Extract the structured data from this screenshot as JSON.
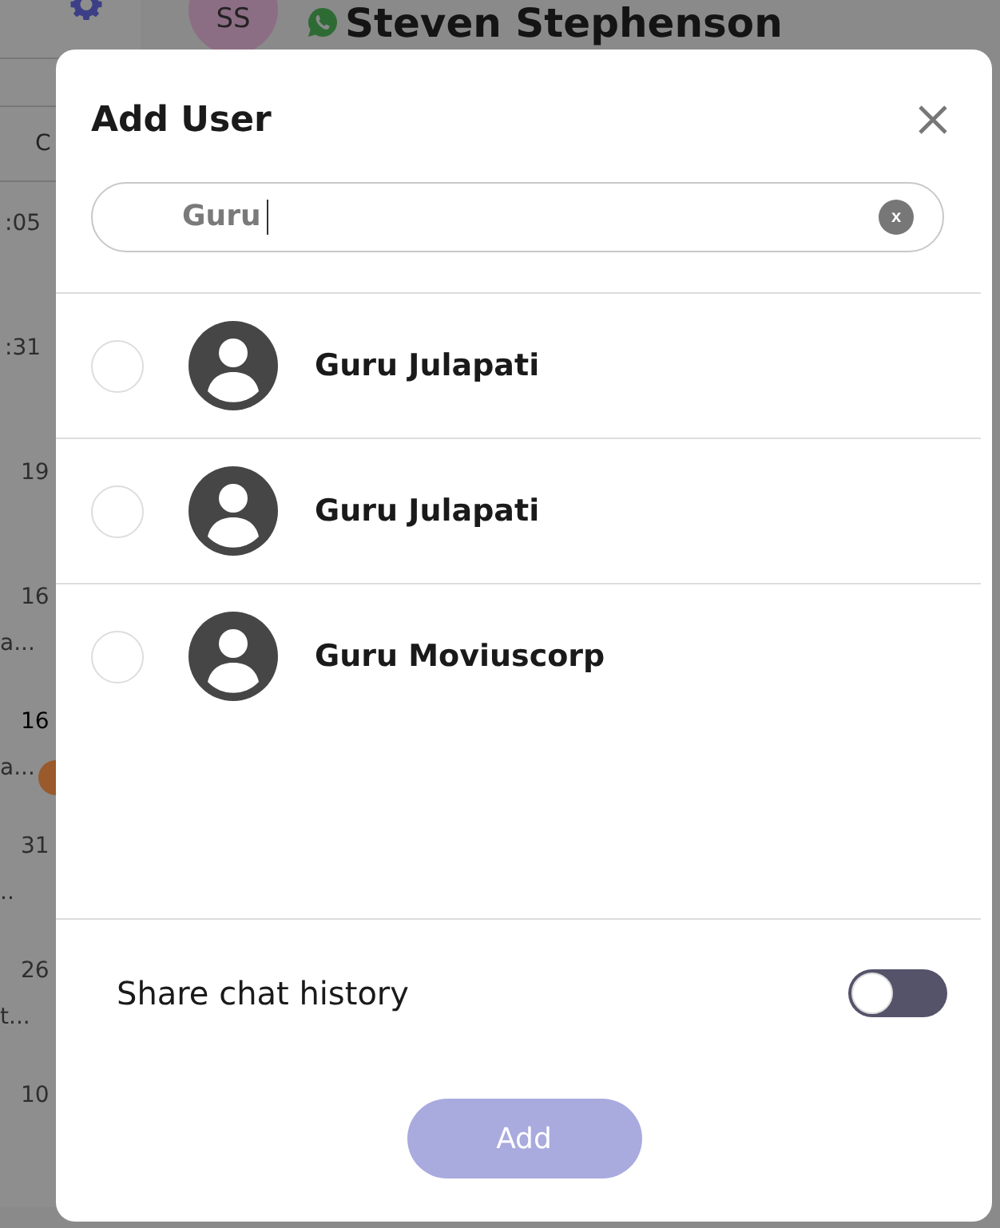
{
  "background": {
    "header": {
      "avatar_initials": "SS",
      "contact_name": "Steven Stephenson"
    },
    "tab_fragment": "C",
    "conversations": [
      {
        "time": ":05",
        "unread": false
      },
      {
        "time": ":31",
        "unread": false
      },
      {
        "time": "19",
        "unread": false
      },
      {
        "time": "16",
        "preview": "a...",
        "unread": false
      },
      {
        "time": "16",
        "preview": "a...",
        "unread": true
      },
      {
        "time": "31",
        "preview": "..",
        "unread": false
      },
      {
        "time": "26",
        "preview": "t...",
        "unread": false
      },
      {
        "time": "10",
        "unread": false
      }
    ]
  },
  "dialog": {
    "title": "Add User",
    "search": {
      "value": "Guru",
      "clear_label": "x"
    },
    "users": [
      {
        "name": "Guru Julapati",
        "selected": false
      },
      {
        "name": "Guru Julapati",
        "selected": false
      },
      {
        "name": "Guru Moviuscorp",
        "selected": false
      }
    ],
    "share_history": {
      "label": "Share chat history",
      "on": false
    },
    "add_button": {
      "label": "Add",
      "disabled": true
    }
  }
}
